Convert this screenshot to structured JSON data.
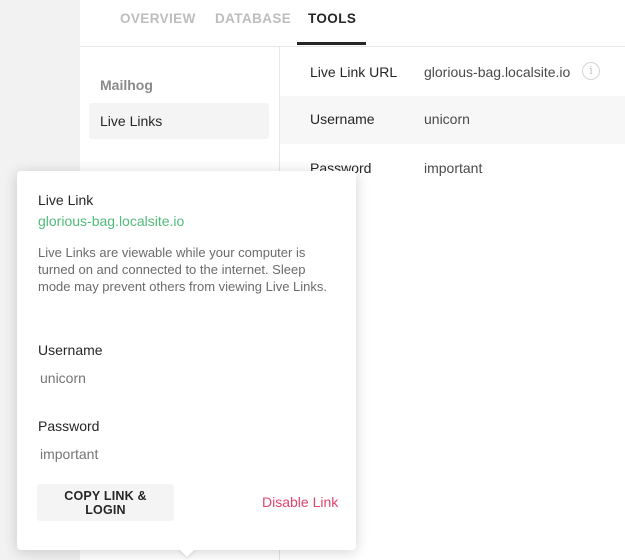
{
  "tabs": [
    {
      "label": "OVERVIEW"
    },
    {
      "label": "DATABASE"
    },
    {
      "label": "TOOLS"
    }
  ],
  "subnav": {
    "items": [
      {
        "label": "Mailhog"
      },
      {
        "label": "Live Links"
      }
    ]
  },
  "details": {
    "url_label": "Live Link URL",
    "url_value": "glorious-bag.localsite.io",
    "info_icon": "i",
    "username_label": "Username",
    "username_value": "unicorn",
    "password_label": "Password",
    "password_value": "important"
  },
  "popover": {
    "title": "Live Link",
    "link": "glorious-bag.localsite.io",
    "description": "Live Links are viewable while your computer is turned on and connected to the internet. Sleep mode may prevent others from viewing Live Links.",
    "username_label": "Username",
    "username_placeholder": "unicorn",
    "password_label": "Password",
    "password_placeholder": "important",
    "copy_button": "COPY LINK & LOGIN",
    "disable_link": "Disable Link"
  },
  "colors": {
    "link_green": "#51bb7b",
    "danger_pink": "#e0456e",
    "active_tab": "#262626",
    "inactive_tab": "#bdbdbd"
  }
}
